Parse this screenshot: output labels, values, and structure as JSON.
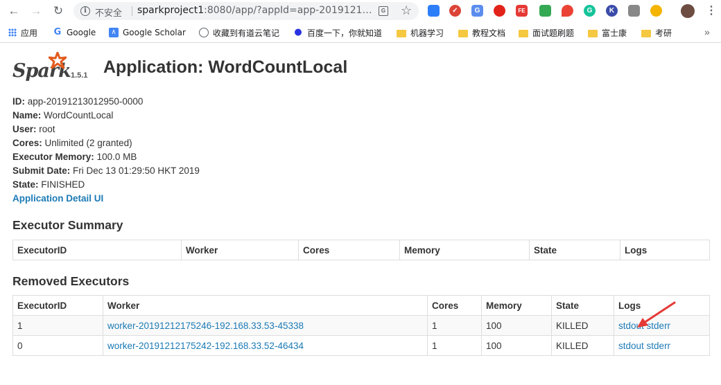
{
  "browser": {
    "insecure_label": "不安全",
    "url_host": "sparkproject1",
    "url_rest": ":8080/app/?appId=app-2019121…",
    "bookmarks": [
      {
        "label": "应用",
        "icon": "apps-grid-icon"
      },
      {
        "label": "Google",
        "icon": "google-icon"
      },
      {
        "label": "Google Scholar",
        "icon": "google-scholar-icon"
      },
      {
        "label": "收藏到有道云笔记",
        "icon": "globe-icon"
      },
      {
        "label": "百度一下，你就知道",
        "icon": "baidu-paw-icon"
      },
      {
        "label": "机器学习",
        "icon": "folder-icon"
      },
      {
        "label": "教程文档",
        "icon": "folder-icon"
      },
      {
        "label": "面试题刷题",
        "icon": "folder-icon"
      },
      {
        "label": "富士康",
        "icon": "folder-icon"
      },
      {
        "label": "考研",
        "icon": "folder-icon"
      }
    ],
    "extension_colors": [
      "#2d7ff9",
      "#db4437",
      "#5b8def",
      "#e2231a",
      "#e53935",
      "#34a853",
      "#ea4335",
      "#15c39a",
      "#3b4ba8",
      "#888888",
      "#f4b400"
    ]
  },
  "spark": {
    "version": "1.5.1",
    "title": "Application: WordCountLocal",
    "props": [
      {
        "key": "ID:",
        "value": "app-20191213012950-0000"
      },
      {
        "key": "Name:",
        "value": "WordCountLocal"
      },
      {
        "key": "User:",
        "value": "root"
      },
      {
        "key": "Cores:",
        "value": "Unlimited (2 granted)"
      },
      {
        "key": "Executor Memory:",
        "value": "100.0 MB"
      },
      {
        "key": "Submit Date:",
        "value": "Fri Dec 13 01:29:50 HKT 2019"
      },
      {
        "key": "State:",
        "value": "FINISHED"
      }
    ],
    "detail_link": "Application Detail UI",
    "executor_summary": {
      "title": "Executor Summary",
      "headers": [
        "ExecutorID",
        "Worker",
        "Cores",
        "Memory",
        "State",
        "Logs"
      ]
    },
    "removed_executors": {
      "title": "Removed Executors",
      "headers": [
        "ExecutorID",
        "Worker",
        "Cores",
        "Memory",
        "State",
        "Logs"
      ],
      "rows": [
        {
          "id": "1",
          "worker": "worker-20191212175246-192.168.33.53-45338",
          "cores": "1",
          "memory": "100",
          "state": "KILLED",
          "stdout": "stdout",
          "stderr": "stderr"
        },
        {
          "id": "0",
          "worker": "worker-20191212175242-192.168.33.52-46434",
          "cores": "1",
          "memory": "100",
          "state": "KILLED",
          "stdout": "stdout",
          "stderr": "stderr"
        }
      ]
    }
  }
}
